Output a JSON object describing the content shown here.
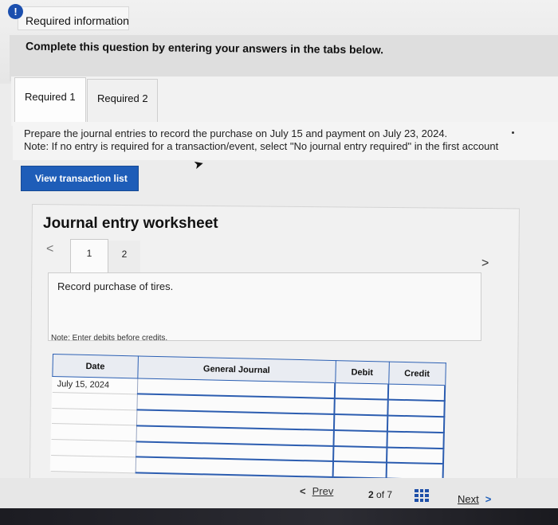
{
  "required_info": {
    "title": "Required information",
    "alert_icon": "!"
  },
  "instruction": "Complete this question by entering your answers in the tabs below.",
  "tabs": [
    {
      "label": "Required 1"
    },
    {
      "label": "Required 2"
    }
  ],
  "prepare": {
    "text": "Prepare the journal entries to record the purchase on July 15 and payment on July 23, 2024.",
    "note": "Note: If no entry is required for a transaction/event, select \"No journal entry required\" in the first account"
  },
  "view_button": "View transaction list",
  "worksheet": {
    "title": "Journal entry worksheet",
    "prev_arrow": "<",
    "next_arrow": ">",
    "tabs": [
      {
        "label": "1"
      },
      {
        "label": "2"
      }
    ],
    "record_text": "Record purchase of tires.",
    "note": "Note: Enter debits before credits."
  },
  "table": {
    "headers": {
      "date": "Date",
      "journal": "General Journal",
      "debit": "Debit",
      "credit": "Credit"
    },
    "rows": [
      {
        "date": "July 15, 2024",
        "account": "",
        "debit": "",
        "credit": ""
      },
      {
        "date": "",
        "account": "",
        "debit": "",
        "credit": ""
      },
      {
        "date": "",
        "account": "",
        "debit": "",
        "credit": ""
      },
      {
        "date": "",
        "account": "",
        "debit": "",
        "credit": ""
      },
      {
        "date": "",
        "account": "",
        "debit": "",
        "credit": ""
      },
      {
        "date": "",
        "account": "",
        "debit": "",
        "credit": ""
      }
    ]
  },
  "nav": {
    "prev_arrow": "<",
    "prev_label": "Prev",
    "current": "2",
    "of_text": "of 7",
    "next_label": "Next",
    "next_arrow": ">",
    "grid_icon": "grid-icon"
  },
  "colors": {
    "accent": "#1e5db8",
    "table_line": "#2c5db0",
    "background": "#ececec"
  }
}
